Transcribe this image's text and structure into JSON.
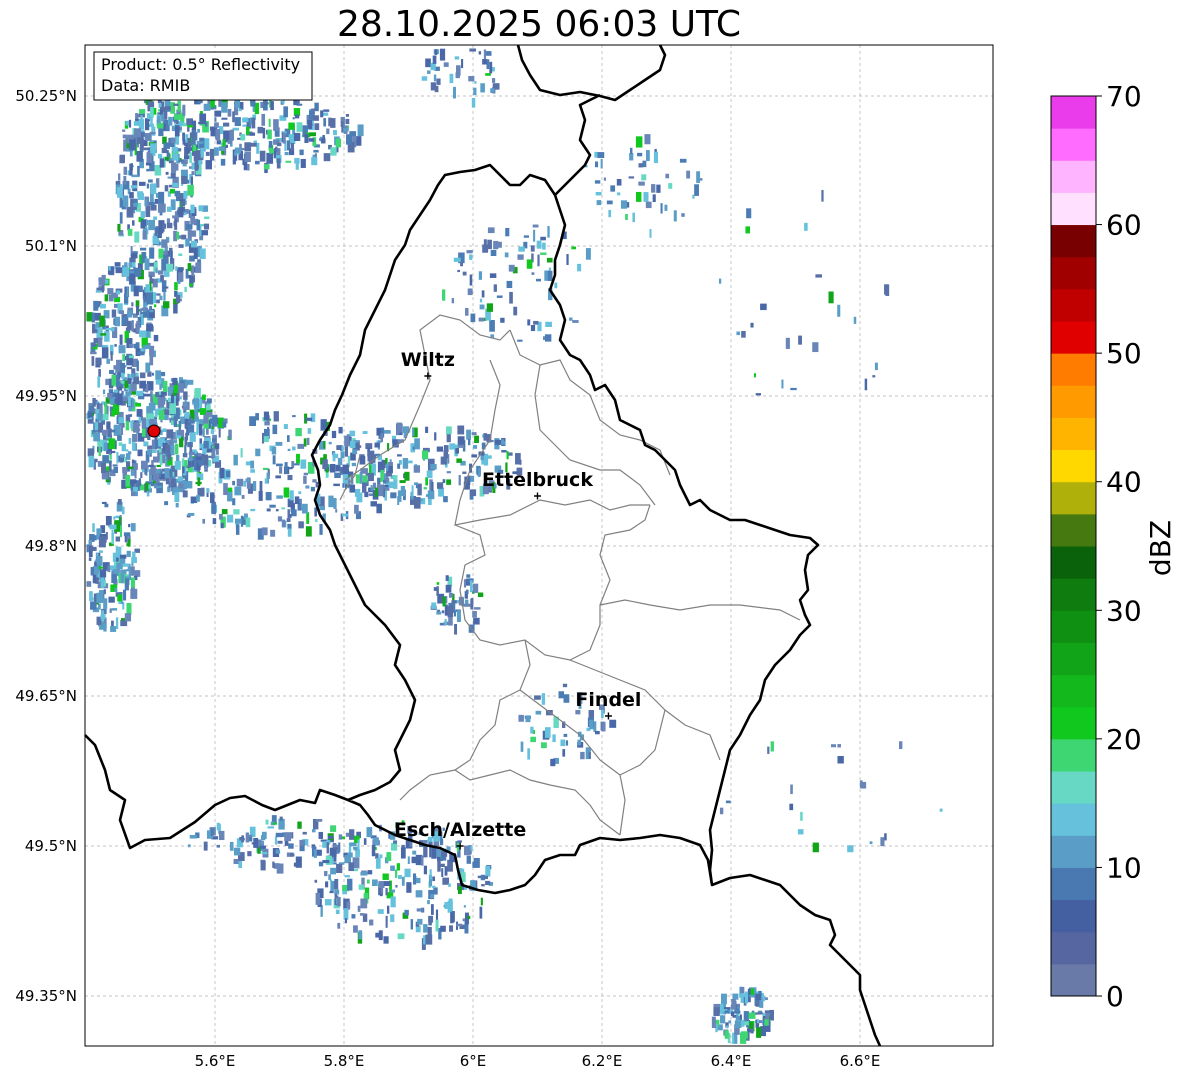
{
  "title": "28.10.2025 06:03 UTC",
  "info_box": {
    "product_line": "Product: 0.5° Reflectivity",
    "data_line": "Data: RMIB"
  },
  "axes": {
    "lon_ticks": [
      "5.6°E",
      "5.8°E",
      "6°E",
      "6.2°E",
      "6.4°E",
      "6.6°E"
    ],
    "lat_ticks": [
      "50.25°N",
      "50.1°N",
      "49.95°N",
      "49.8°N",
      "49.65°N",
      "49.5°N",
      "49.35°N"
    ]
  },
  "cities": [
    {
      "name": "Wiltz",
      "lon": 5.93,
      "lat": 49.97
    },
    {
      "name": "Ettelbruck",
      "lon": 6.1,
      "lat": 49.85
    },
    {
      "name": "Findel",
      "lon": 6.21,
      "lat": 49.63
    },
    {
      "name": "Esch/Alzette",
      "lon": 5.98,
      "lat": 49.5
    }
  ],
  "radar_site_color": "#e00000",
  "colorbar": {
    "label": "dBZ",
    "tick_labels": [
      "0",
      "10",
      "20",
      "30",
      "40",
      "50",
      "60",
      "70"
    ],
    "min": 0,
    "max": 70,
    "colors": [
      "#6a7aa8",
      "#5566a0",
      "#4460a0",
      "#4a78b0",
      "#5a9ec8",
      "#66c2dc",
      "#66d8c4",
      "#3ed672",
      "#10c81e",
      "#12b81c",
      "#12a418",
      "#109012",
      "#0e7c0e",
      "#0a620a",
      "#467a10",
      "#b0b00a",
      "#ffd800",
      "#ffb400",
      "#ff9a00",
      "#ff7c00",
      "#e00000",
      "#c00000",
      "#a00000",
      "#780000",
      "#ffe0ff",
      "#ffb4ff",
      "#ff6cff",
      "#ea3cea"
    ]
  }
}
